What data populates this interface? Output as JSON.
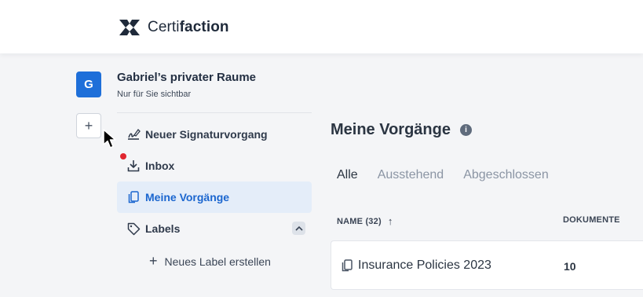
{
  "brand": {
    "name_light": "Certi",
    "name_bold": "faction",
    "logo_icon": "certifaction-logo-icon"
  },
  "workspace": {
    "avatar_letter": "G",
    "title": "Gabriel’s privater Raume",
    "subtitle": "Nur für Sie sichtbar",
    "add_label": "+"
  },
  "sidebar": {
    "items": [
      {
        "label": "Neuer Signaturvorgang",
        "icon": "signature-icon"
      },
      {
        "label": "Inbox",
        "icon": "inbox-download-icon",
        "badge_color": "#e0262f"
      },
      {
        "label": "Meine Vorgänge",
        "icon": "documents-icon",
        "active": true
      },
      {
        "label": "Labels",
        "icon": "tag-icon"
      }
    ],
    "new_label": "Neues Label erstellen"
  },
  "main": {
    "title": "Meine Vorgänge",
    "info_glyph": "i",
    "tabs": [
      {
        "label": "Alle",
        "active": true
      },
      {
        "label": "Ausstehend"
      },
      {
        "label": "Abgeschlossen"
      }
    ],
    "table": {
      "columns": [
        "NAME (32)",
        "DOKUMENTE"
      ],
      "sort_glyph": "↑",
      "rows": [
        {
          "name": "Insurance Policies 2023",
          "documents": "10"
        }
      ]
    }
  },
  "colors": {
    "accent": "#1e6fd9",
    "active_bg": "#e4edf9",
    "active_text": "#1b66cf",
    "notification": "#e0262f"
  }
}
